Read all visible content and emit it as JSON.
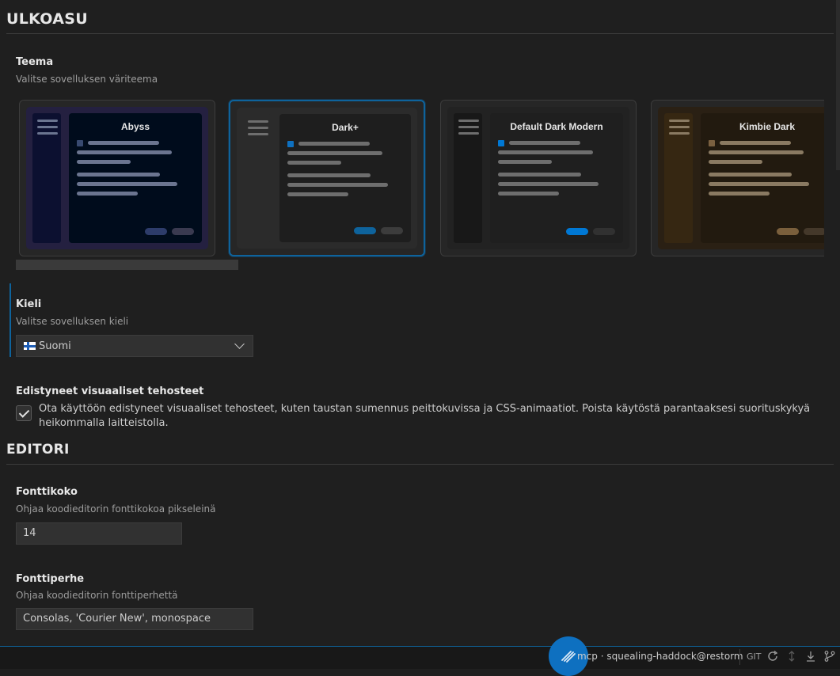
{
  "appearance": {
    "section_title": "ULKOASU",
    "theme": {
      "title": "Teema",
      "description": "Valitse sovelluksen väriteema",
      "cards": [
        {
          "name": "Abyss",
          "selected": false,
          "colors": {
            "frame": "#242040",
            "side": "#0c1030",
            "main": "#000c1c",
            "line": "#6b7590",
            "dot": "#384a70",
            "btn1": "#2d3c6a",
            "btn2": "#3a3a50"
          }
        },
        {
          "name": "Dark+",
          "selected": true,
          "colors": {
            "frame": "#2b2b2b",
            "side": "#2b2b2b",
            "main": "#1e1e1e",
            "line": "#6e6e6e",
            "dot": "#0e70c0",
            "btn1": "#0e639c",
            "btn2": "#3c3c3c"
          }
        },
        {
          "name": "Default Dark Modern",
          "selected": false,
          "colors": {
            "frame": "#222222",
            "side": "#181818",
            "main": "#1f1f1f",
            "line": "#6e6e6e",
            "dot": "#0078d4",
            "btn1": "#0078d4",
            "btn2": "#313131"
          }
        },
        {
          "name": "Kimbie Dark",
          "selected": false,
          "colors": {
            "frame": "#2a2014",
            "side": "#362712",
            "main": "#221a0f",
            "line": "#8a7a62",
            "dot": "#7a6040",
            "btn1": "#7a5f3c",
            "btn2": "#44382a"
          }
        }
      ]
    },
    "language": {
      "title": "Kieli",
      "description": "Valitse sovelluksen kieli",
      "selected": "Suomi"
    },
    "effects": {
      "title": "Edistyneet visuaaliset tehosteet",
      "checked": true,
      "label": "Ota käyttöön edistyneet visuaaliset tehosteet, kuten taustan sumennus peittokuvissa ja CSS-animaatiot. Poista käytöstä parantaaksesi suorituskykyä heikommalla laitteistolla."
    }
  },
  "editor": {
    "section_title": "EDITORI",
    "font_size": {
      "title": "Fonttikoko",
      "description": "Ohjaa koodieditorin fonttikokoa pikseleinä",
      "value": "14"
    },
    "font_family": {
      "title": "Fonttiperhe",
      "description": "Ohjaa koodieditorin fonttiperhettä",
      "value": "Consolas, 'Courier New', monospace"
    }
  },
  "status_bar": {
    "connection": "mcp · squealing-haddock@restorm",
    "git_label": "GIT",
    "icons": [
      "refresh-icon",
      "push-pull-icon",
      "download-icon",
      "branch-icon"
    ]
  }
}
